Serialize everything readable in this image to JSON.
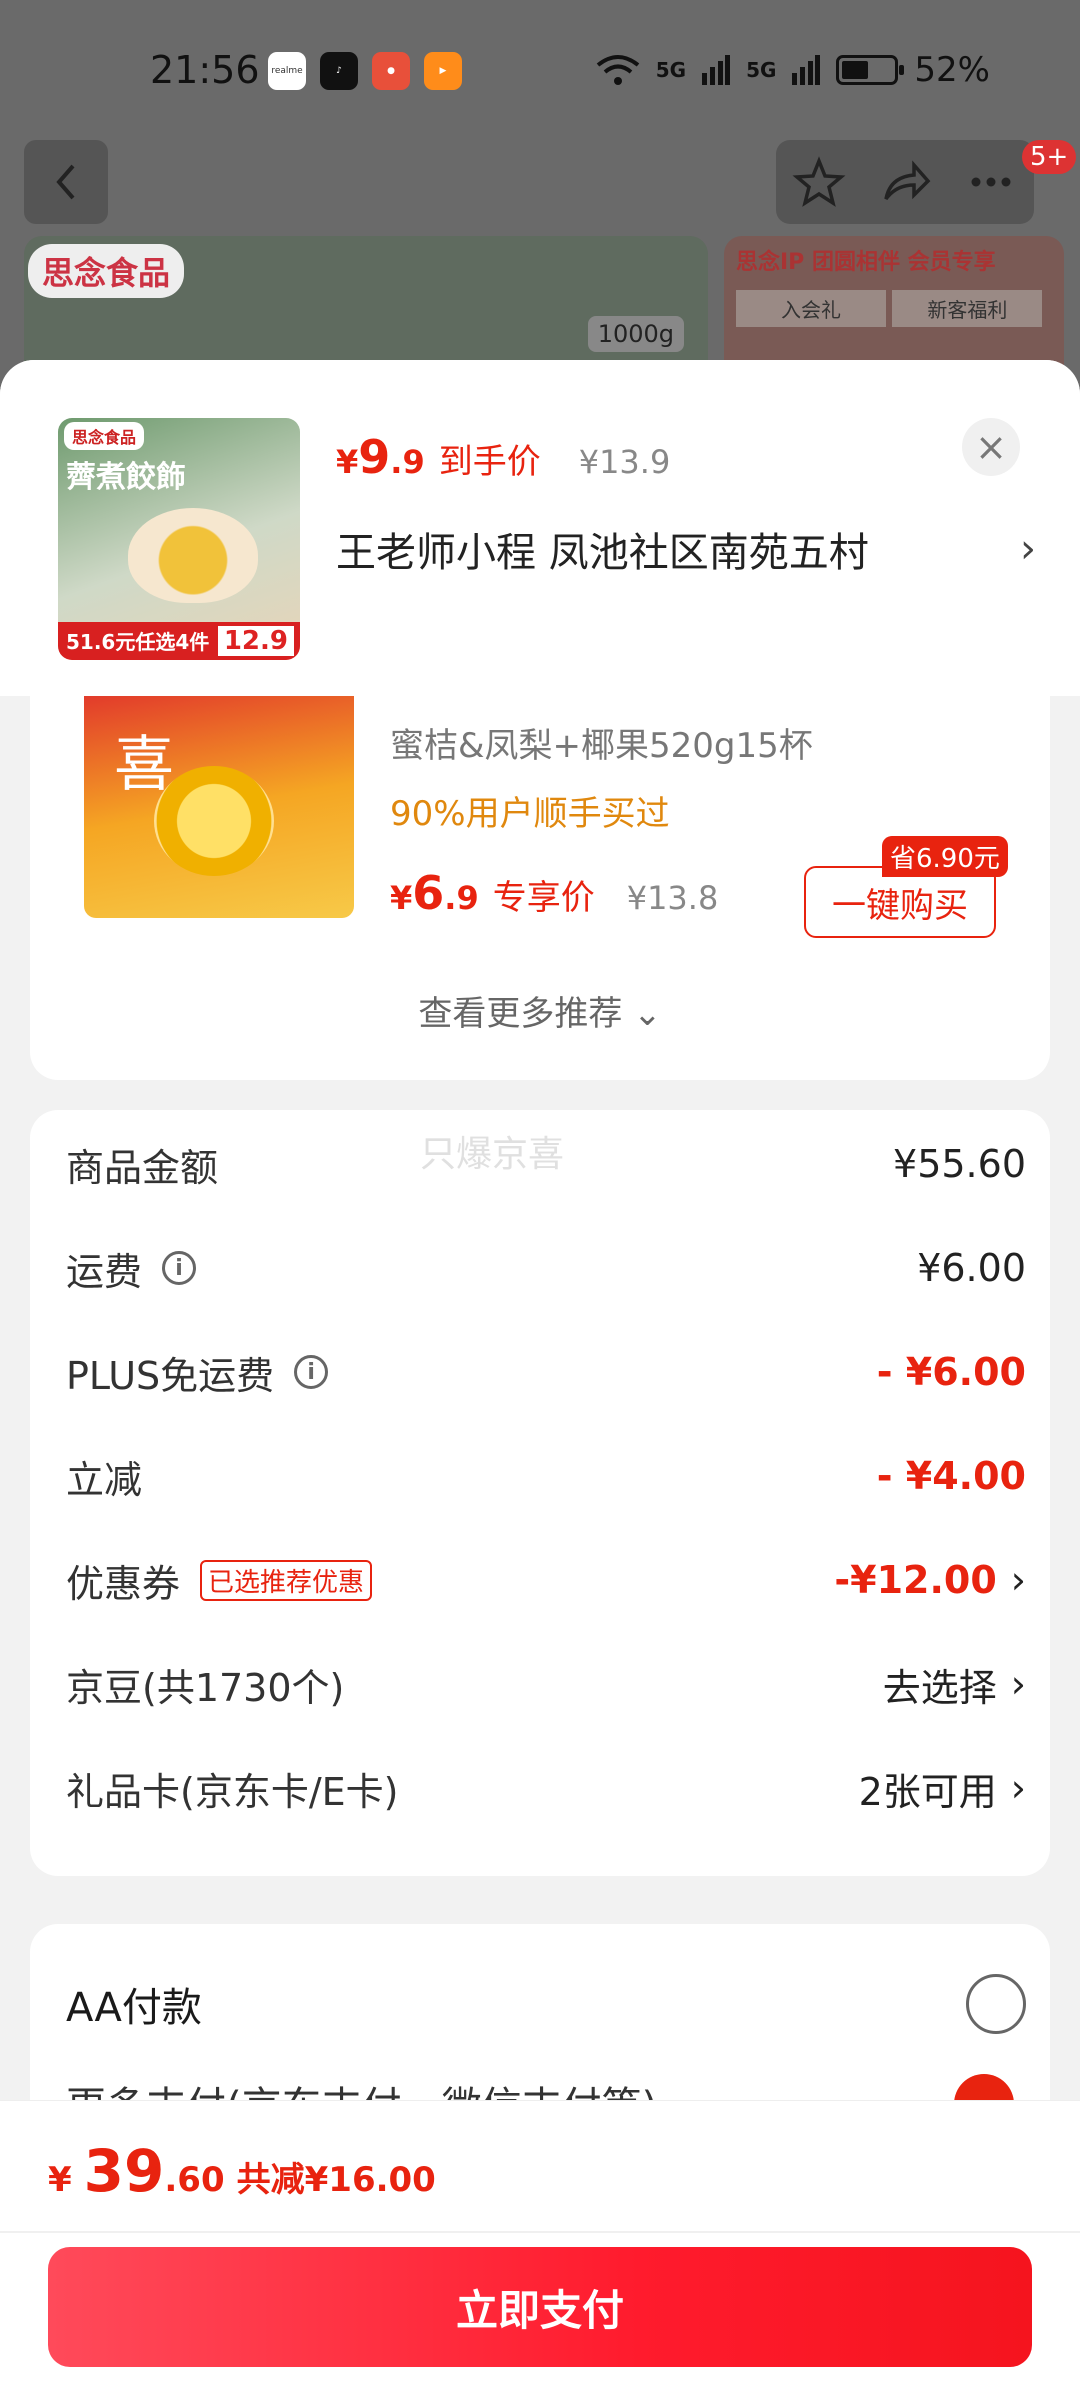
{
  "status_bar": {
    "time": "21:56",
    "apps": [
      {
        "icon": "realme-icon",
        "label": "realme",
        "color": "#ffffff"
      },
      {
        "icon": "douyin-icon",
        "label": "",
        "color": "#111111"
      },
      {
        "icon": "app-orange-icon",
        "label": "",
        "color": "#e8503a"
      },
      {
        "icon": "video-app-icon",
        "label": "",
        "color": "#ff8c1a"
      }
    ],
    "network_1": "5G",
    "network_2": "5G",
    "battery_percent": "52%",
    "battery_level": 0.52
  },
  "top_nav": {
    "badge": "5+"
  },
  "banner": {
    "brand": "思念食品",
    "weight": "1000g",
    "right_header": "思念IP 团圆相伴 会员专享",
    "right_box_1": "入会礼",
    "right_box_2": "新客福利"
  },
  "product": {
    "thumb_logo": "思念食品",
    "thumb_title": "薺煮餃飾",
    "thumb_bottom": "51.6元任选4件",
    "thumb_price": "12.9",
    "price_yen": "¥",
    "price_int": "9",
    "price_dec": ".9",
    "price_label": "到手价",
    "price_orig": "¥13.9",
    "address": "王老师小程  凤池社区南苑五村"
  },
  "recommend": {
    "name": "蜜桔&凤梨+椰果520g15杯",
    "social_proof": "90%用户顺手买过",
    "price_yen": "¥",
    "price_int": "6",
    "price_dec": ".9",
    "price_label": "专享价",
    "price_orig": "¥13.8",
    "save_tag": "省6.90元",
    "buy_label": "一键购买",
    "more_label": "查看更多推荐"
  },
  "watermark": "只爆京喜",
  "fees": [
    {
      "label": "商品金额",
      "value": "¥55.60",
      "info": false,
      "red": false,
      "chev": false,
      "tag": ""
    },
    {
      "label": "运费",
      "value": "¥6.00",
      "info": true,
      "red": false,
      "chev": false,
      "tag": ""
    },
    {
      "label": "PLUS免运费",
      "value": "- ¥6.00",
      "info": true,
      "red": true,
      "chev": false,
      "tag": ""
    },
    {
      "label": "立减",
      "value": "- ¥4.00",
      "info": false,
      "red": true,
      "chev": false,
      "tag": ""
    },
    {
      "label": "优惠券",
      "value": "-¥12.00",
      "info": false,
      "red": true,
      "chev": true,
      "tag": "已选推荐优惠"
    },
    {
      "label": "京豆(共1730个)",
      "value": "去选择",
      "info": false,
      "red": false,
      "chev": true,
      "tag": ""
    },
    {
      "label": "礼品卡(京东卡/E卡)",
      "value": "2张可用",
      "info": false,
      "red": false,
      "chev": true,
      "tag": ""
    }
  ],
  "payment": {
    "aa_label": "AA付款",
    "other_label": "更多支付(京东支付、微信支付等)"
  },
  "footer": {
    "yen": "¥",
    "total_int": "39",
    "total_dec": ".60",
    "saved": "共减¥16.00",
    "pay_label": "立即支付"
  },
  "colors": {
    "accent": "#e8230f",
    "social": "#e0880e"
  }
}
